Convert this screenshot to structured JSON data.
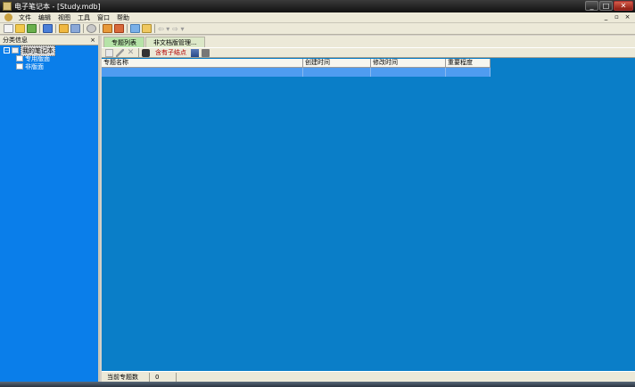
{
  "window": {
    "title": "电子笔记本 - [Study.mdb]",
    "buttons": {
      "minimize": "_",
      "maximize": "□",
      "close": "✕"
    }
  },
  "menubar": {
    "items": [
      "文件",
      "编辑",
      "视图",
      "工具",
      "窗口",
      "帮助"
    ],
    "mdi_buttons": {
      "minimize": "_",
      "restore": "▫",
      "close": "×"
    }
  },
  "toolbar": {
    "icons": [
      "new-icon",
      "open-icon",
      "save-icon",
      "layout-icon",
      "folder-icon",
      "save-as-icon",
      "search-icon",
      "palette-icon",
      "cut-icon",
      "copy-icon",
      "paste-icon"
    ],
    "back_arrow": "⇦ ▾",
    "forward_arrow": "⇨ ▾"
  },
  "left_pane": {
    "title": "分类信息",
    "close": "×",
    "tree": {
      "root": {
        "label": "我的笔记本",
        "expander": "−"
      },
      "children": [
        "专用版面",
        "非版面"
      ]
    }
  },
  "tabs": [
    {
      "label": "专题列表",
      "active": true
    },
    {
      "label": "非文档版管理...",
      "active": false
    }
  ],
  "sub_toolbar": {
    "icons": [
      "new-doc-icon",
      "edit-icon",
      "delete-icon",
      "binoculars-icon"
    ],
    "include_label": "含有子结点",
    "extra_icons": [
      "chart-icon",
      "settings-icon"
    ]
  },
  "grid": {
    "columns": [
      "专题名称",
      "创建时间",
      "修改时间",
      "重要程度"
    ]
  },
  "statusbar": {
    "label": "当前专题数",
    "count": "0"
  }
}
